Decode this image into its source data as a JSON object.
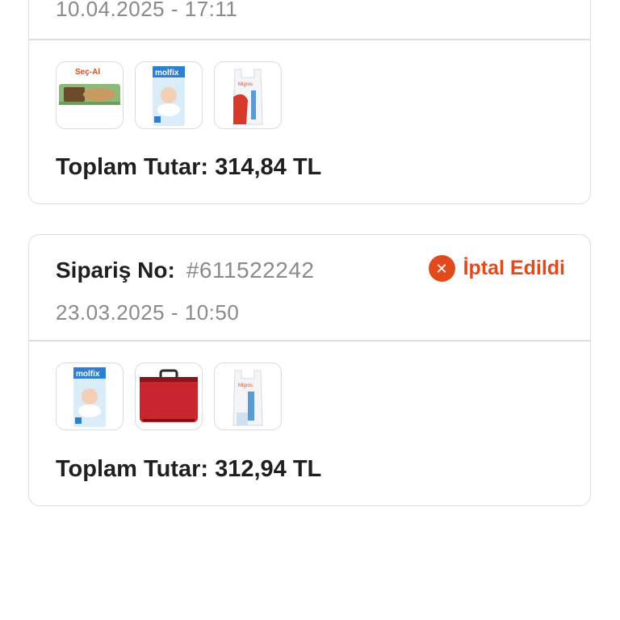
{
  "orders": [
    {
      "date": "10.04.2025 - 17:11",
      "products": [
        {
          "name": "Seç-Al",
          "type": "chocolate-bar"
        },
        {
          "name": "molfix",
          "type": "diaper-pack"
        },
        {
          "name": "Migros",
          "type": "plastic-bag"
        }
      ],
      "total": "Toplam Tutar: 314,84 TL"
    },
    {
      "order_label": "Sipariş No:",
      "order_number": "#611522242",
      "status": "İptal Edildi",
      "status_color": "#e24a1c",
      "date": "23.03.2025 - 10:50",
      "products": [
        {
          "name": "molfix",
          "type": "diaper-pack"
        },
        {
          "type": "red-bag"
        },
        {
          "name": "Migros",
          "type": "plastic-bag"
        }
      ],
      "total": "Toplam Tutar: 312,94 TL"
    }
  ]
}
